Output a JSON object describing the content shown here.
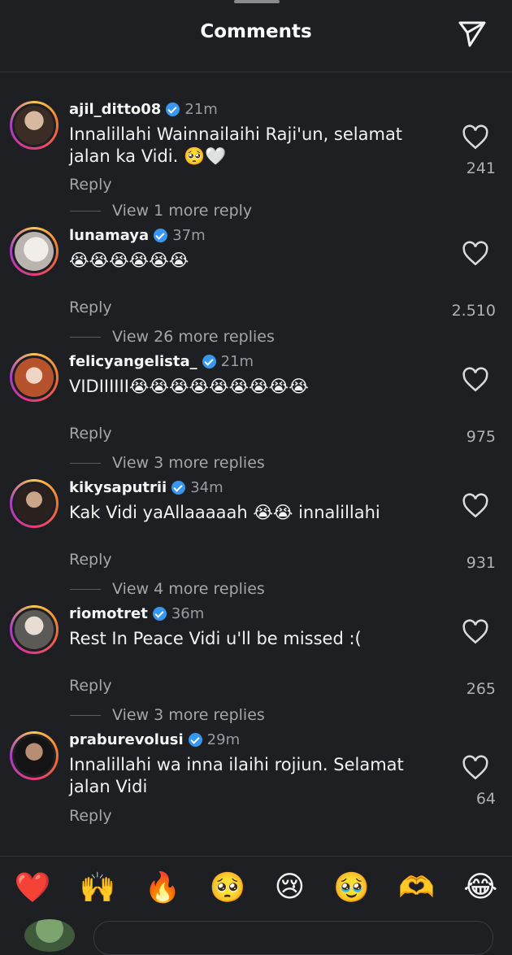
{
  "header": {
    "title": "Comments"
  },
  "icons": {
    "share": "send-icon",
    "like": "heart-outline-icon",
    "verified": "verified-badge-icon"
  },
  "colors": {
    "background": "#1e1f22",
    "verified": "#3797f0",
    "muted": "#a5a6aa"
  },
  "comments": [
    {
      "username": "ajil_ditto08",
      "verified": true,
      "time": "21m",
      "text": "Innalillahi Wainnailaihi Raji'un, selamat jalan ka Vidi. 🥺🤍",
      "reply": "Reply",
      "more": "View 1 more reply",
      "likes": "241"
    },
    {
      "username": "lunamaya",
      "verified": true,
      "time": "37m",
      "text": "😭😭😭😭😭😭",
      "reply": "Reply",
      "more": "View 26 more replies",
      "likes": "2.510"
    },
    {
      "username": "felicyangelista_",
      "verified": true,
      "time": "21m",
      "text": "VIDIIIIII😭😭😭😭😭😭😭😭😭",
      "reply": "Reply",
      "more": "View 3 more replies",
      "likes": "975"
    },
    {
      "username": "kikysaputrii",
      "verified": true,
      "time": "34m",
      "text": "Kak Vidi yaAllaaaaah 😭😭 innalillahi",
      "reply": "Reply",
      "more": "View 4 more replies",
      "likes": "931"
    },
    {
      "username": "riomotret",
      "verified": true,
      "time": "36m",
      "text": "Rest In Peace Vidi u'll be missed :(",
      "reply": "Reply",
      "more": "View 3 more replies",
      "likes": "265"
    },
    {
      "username": "praburevolusi",
      "verified": true,
      "time": "29m",
      "text": "Innalillahi wa inna ilaihi rojiun. Selamat jalan Vidi",
      "reply": "Reply",
      "likes": "64"
    }
  ],
  "emoji_bar": [
    "❤️",
    "🙌",
    "🔥",
    "🥺",
    "😢",
    "🥹",
    "🫶",
    "😂"
  ]
}
